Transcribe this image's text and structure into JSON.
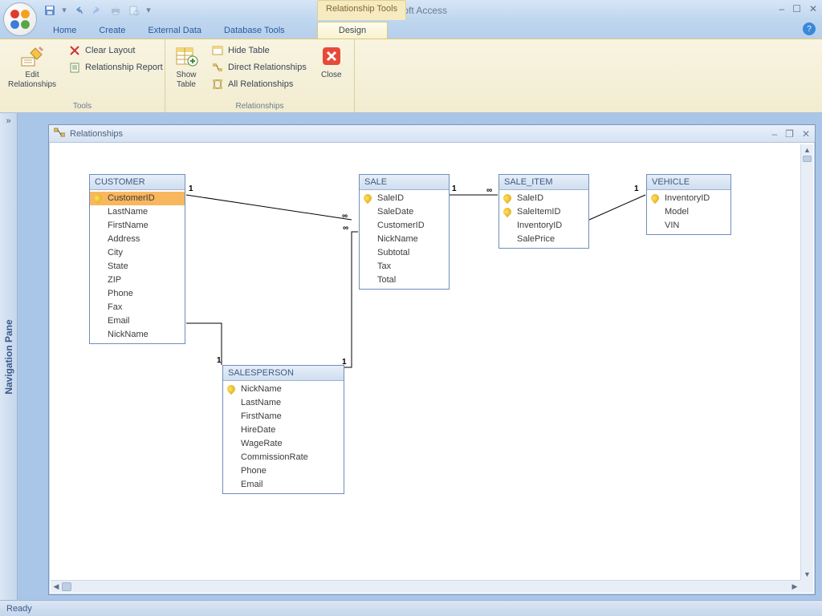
{
  "titlebar": {
    "app_name": "Microsoft Access",
    "context_tab_group": "Relationship Tools"
  },
  "tabs": {
    "home": "Home",
    "create": "Create",
    "external_data": "External Data",
    "database_tools": "Database Tools",
    "design": "Design"
  },
  "ribbon": {
    "tools": {
      "edit_relationships": "Edit\nRelationships",
      "clear_layout": "Clear Layout",
      "relationship_report": "Relationship Report",
      "group_label": "Tools"
    },
    "relationships": {
      "show_table": "Show\nTable",
      "hide_table": "Hide Table",
      "direct_relationships": "Direct Relationships",
      "all_relationships": "All Relationships",
      "close": "Close",
      "group_label": "Relationships"
    }
  },
  "navpane": {
    "label": "Navigation Pane",
    "chevron": "»"
  },
  "document": {
    "title": "Relationships"
  },
  "tables": {
    "customer": {
      "title": "CUSTOMER",
      "fields": [
        "CustomerID",
        "LastName",
        "FirstName",
        "Address",
        "City",
        "State",
        "ZIP",
        "Phone",
        "Fax",
        "Email",
        "NickName"
      ],
      "keys": [
        0
      ],
      "selected": 0
    },
    "sale": {
      "title": "SALE",
      "fields": [
        "SaleID",
        "SaleDate",
        "CustomerID",
        "NickName",
        "Subtotal",
        "Tax",
        "Total"
      ],
      "keys": [
        0
      ]
    },
    "sale_item": {
      "title": "SALE_ITEM",
      "fields": [
        "SaleID",
        "SaleItemID",
        "InventoryID",
        "SalePrice"
      ],
      "keys": [
        0,
        1
      ]
    },
    "vehicle": {
      "title": "VEHICLE",
      "fields": [
        "InventoryID",
        "Model",
        "VIN"
      ],
      "keys": [
        0
      ]
    },
    "salesperson": {
      "title": "SALESPERSON",
      "fields": [
        "NickName",
        "LastName",
        "FirstName",
        "HireDate",
        "WageRate",
        "CommissionRate",
        "Phone",
        "Email"
      ],
      "keys": [
        0
      ]
    }
  },
  "cardinality": {
    "one": "1",
    "many": "∞"
  },
  "statusbar": {
    "text": "Ready"
  }
}
